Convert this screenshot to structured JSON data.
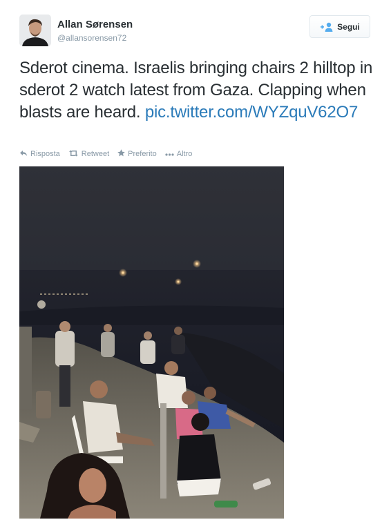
{
  "user": {
    "name": "Allan Sørensen",
    "handle": "@allansorensen72"
  },
  "follow_button": {
    "label": "Segui",
    "icon": "add-user-icon"
  },
  "tweet": {
    "text": "Sderot cinema. Israelis bringing chairs 2 hilltop in sderot 2 watch latest from Gaza. Clapping when blasts are heard.",
    "link": "pic.twitter.com/WYZquV62O7"
  },
  "actions": [
    {
      "label": "Risposta",
      "icon": "reply-icon"
    },
    {
      "label": "Retweet",
      "icon": "retweet-icon"
    },
    {
      "label": "Preferito",
      "icon": "star-icon"
    },
    {
      "label": "Altro",
      "icon": "more-icon"
    }
  ],
  "colors": {
    "link": "#2b7bb9",
    "muted": "#8899a6",
    "text": "#292f33",
    "accent": "#55acee"
  }
}
